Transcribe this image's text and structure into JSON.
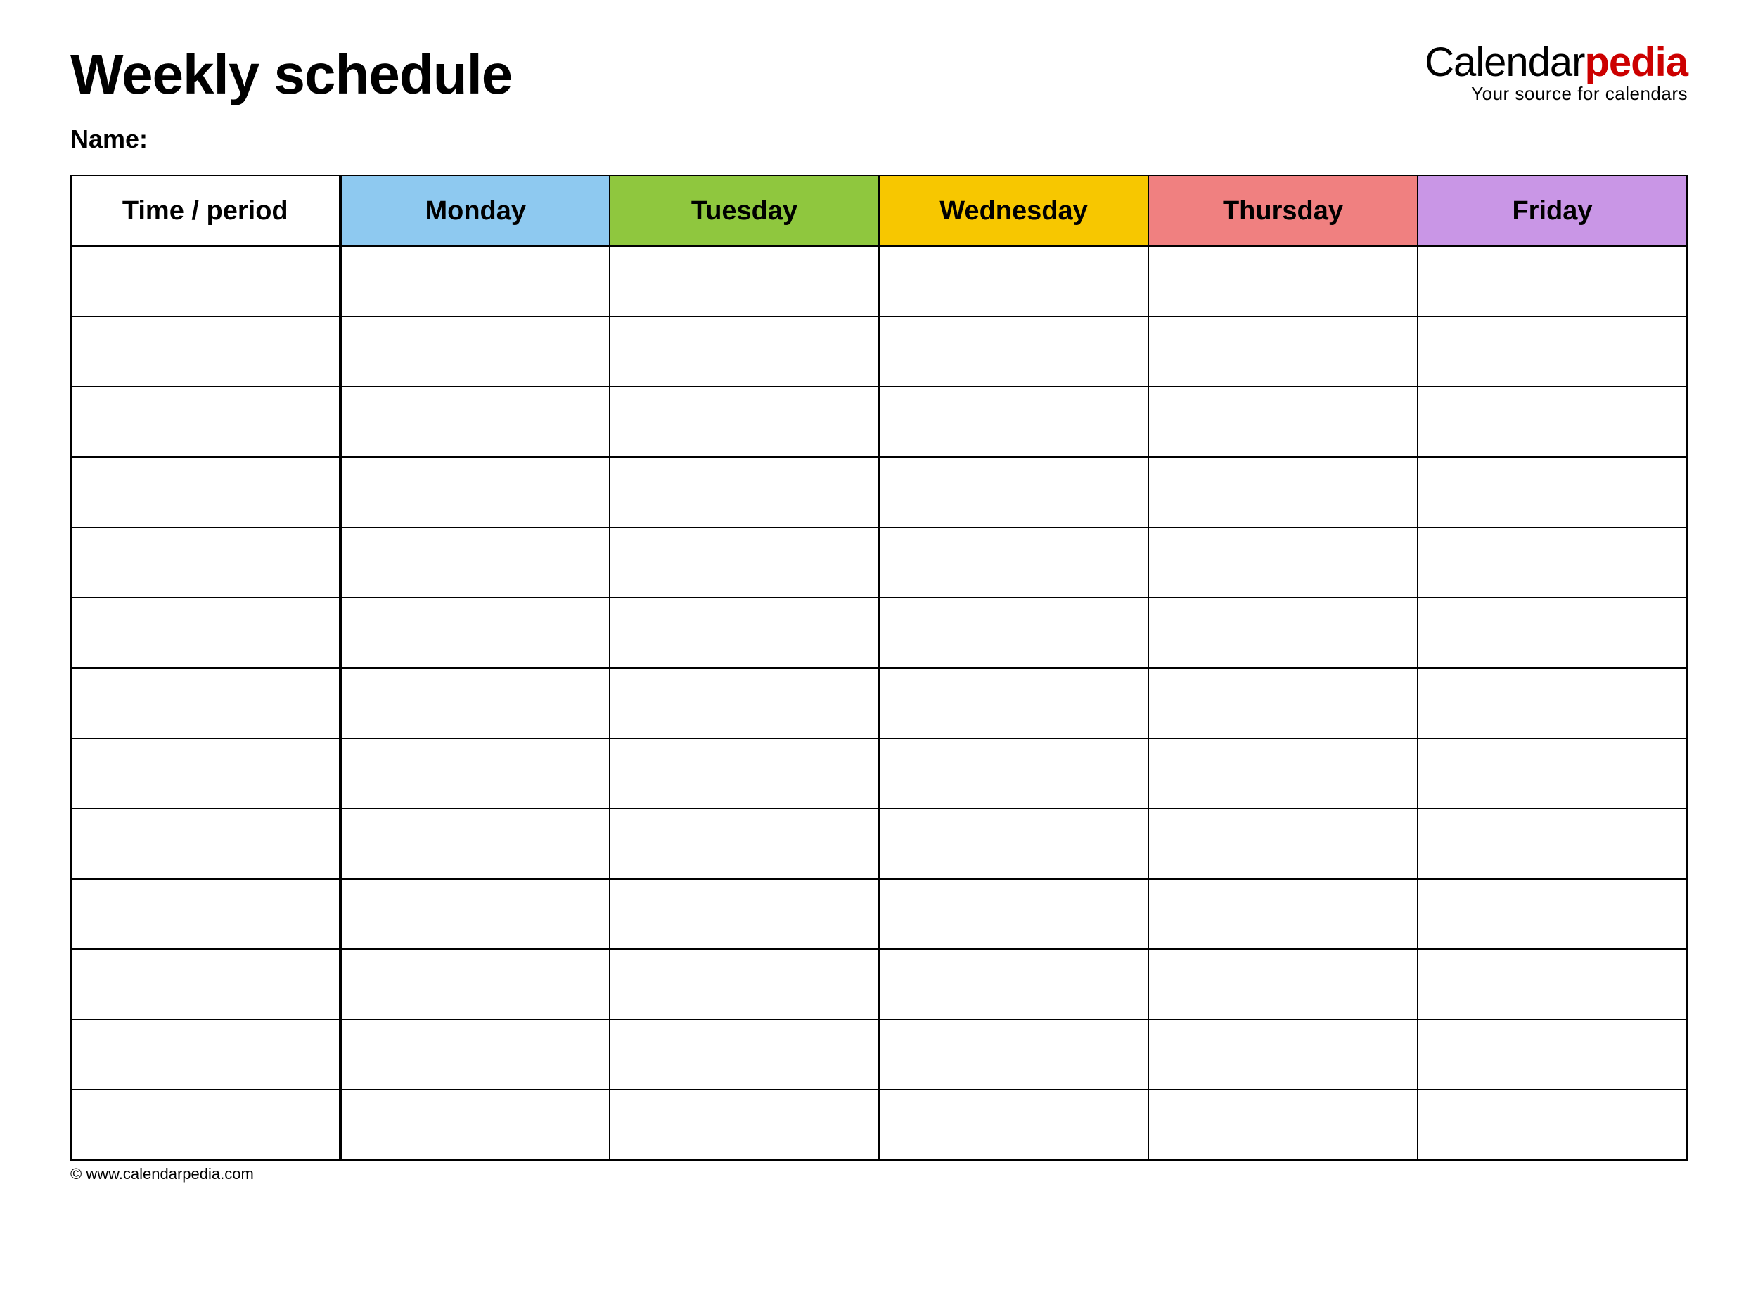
{
  "header": {
    "title": "Weekly schedule",
    "name_label": "Name:"
  },
  "logo": {
    "part1": "Calendar",
    "part2": "pedia",
    "tagline": "Your source for calendars"
  },
  "table": {
    "columns": [
      {
        "label": "Time / period",
        "color": "#ffffff"
      },
      {
        "label": "Monday",
        "color": "#8ec9f0"
      },
      {
        "label": "Tuesday",
        "color": "#8fc73e"
      },
      {
        "label": "Wednesday",
        "color": "#f7c700"
      },
      {
        "label": "Thursday",
        "color": "#f08080"
      },
      {
        "label": "Friday",
        "color": "#c996e6"
      }
    ],
    "row_count": 13
  },
  "footer": {
    "copyright": "© www.calendarpedia.com"
  }
}
